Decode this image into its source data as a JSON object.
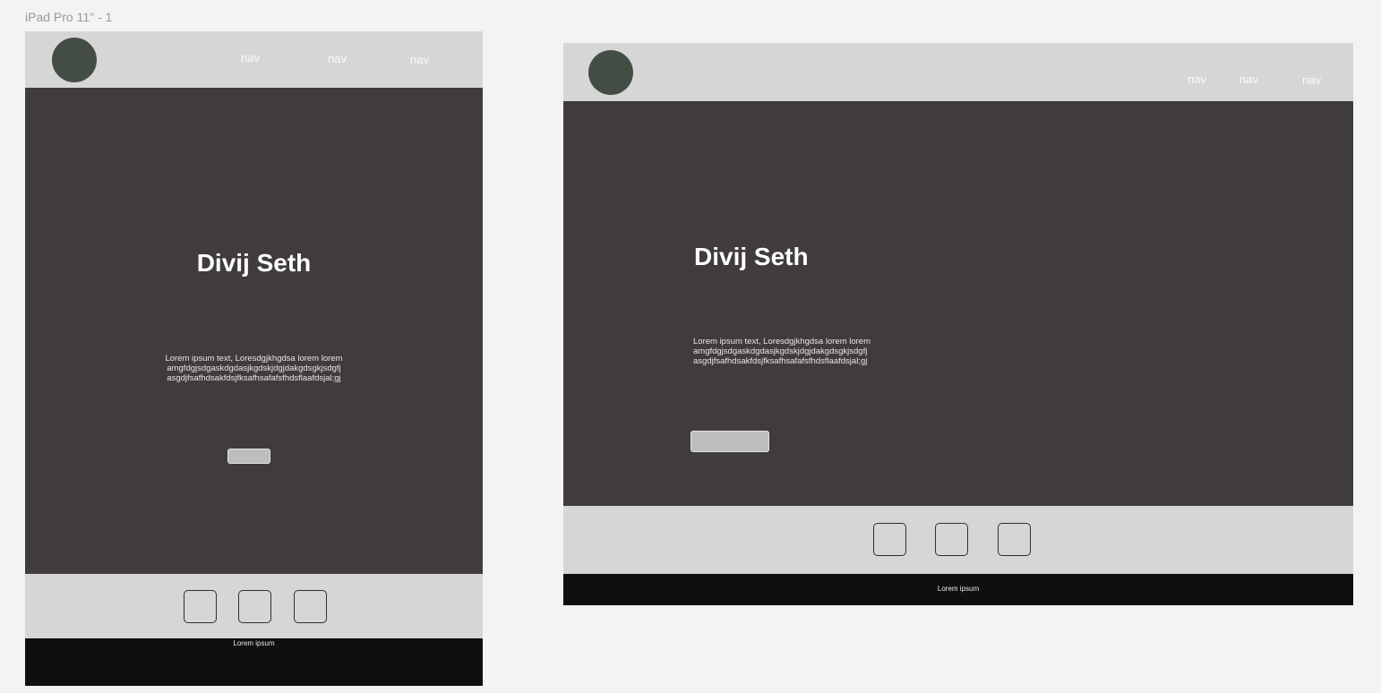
{
  "frame_label": "iPad Pro 11\" - 1",
  "nav": [
    "nav",
    "nav",
    "nav"
  ],
  "hero": {
    "title": "Divij Seth",
    "text_lines": [
      "Lorem ipsum text, Loresdgjkhgdsa lorem lorem",
      "amgfdgjsdgaskdgdasjkgdskjdgjdakgdsgkjsdgfj",
      "asgdjfsafhdsakfdsjfksafhsafafsfhdsflaafdsjal;gj"
    ]
  },
  "footer": {
    "text": "Lorem ipsum"
  },
  "colors": {
    "canvas": "#f3f3f3",
    "header": "#d6d6d6",
    "logo": "#434d43",
    "hero": "#403c3b",
    "button": "#bdbdbd",
    "footer": "#0f0f0f"
  },
  "icons": [
    "logo-circle",
    "social-square",
    "social-square",
    "social-square"
  ]
}
